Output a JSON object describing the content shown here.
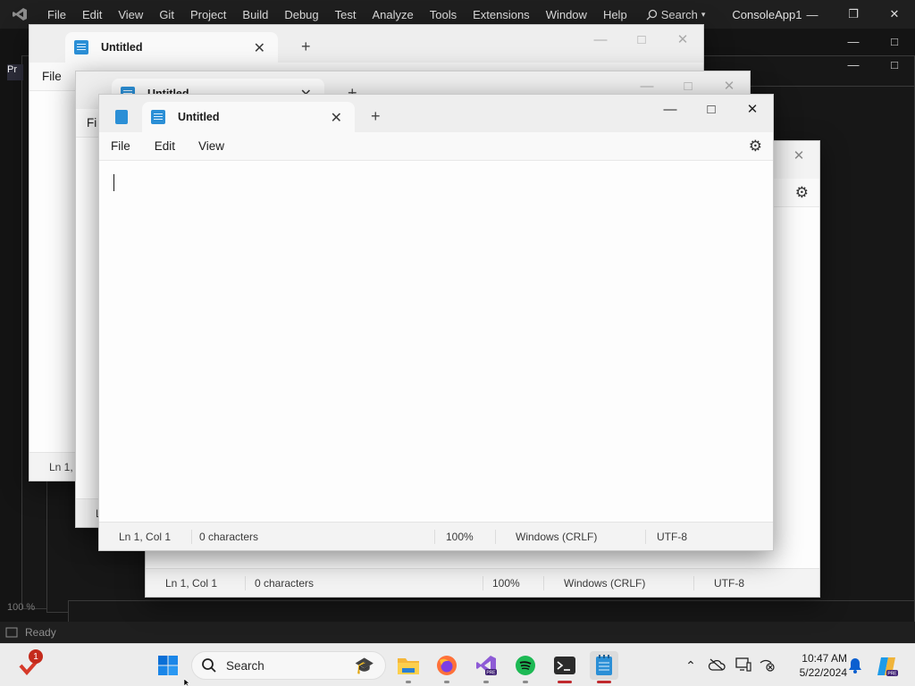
{
  "vs": {
    "menu": [
      "File",
      "Edit",
      "View",
      "Git",
      "Project",
      "Build",
      "Debug",
      "Test",
      "Analyze",
      "Tools",
      "Extensions",
      "Window",
      "Help"
    ],
    "search_label": "Search",
    "solution_name": "ConsoleApp1",
    "status_text": "Ready",
    "zoom_text": "100 %",
    "left_tab_label": "Pr"
  },
  "notepad_back": {
    "tab_title": "Untitled",
    "menu": [
      "File"
    ],
    "status": {
      "position": "Ln 1, C"
    }
  },
  "notepad_middle": {
    "tab_title": "Untitled",
    "menu": [
      "Fi"
    ],
    "status": {
      "position": "L"
    }
  },
  "notepad_right": {
    "status": {
      "position": "Ln 1, Col 1",
      "characters": "0 characters",
      "zoom": "100%",
      "line_ending": "Windows (CRLF)",
      "encoding": "UTF-8"
    }
  },
  "notepad_front": {
    "tab_title": "Untitled",
    "menu": [
      "File",
      "Edit",
      "View"
    ],
    "status": {
      "position": "Ln 1, Col 1",
      "characters": "0 characters",
      "zoom": "100%",
      "line_ending": "Windows (CRLF)",
      "encoding": "UTF-8"
    }
  },
  "taskbar": {
    "search_label": "Search",
    "notification_badge": "1",
    "time": "10:47 AM",
    "date": "5/22/2024",
    "pinned": [
      "start-icon",
      "file-explorer-icon",
      "firefox-icon",
      "visual-studio-preview-icon",
      "spotify-icon",
      "terminal-icon",
      "notepad-icon"
    ],
    "colors": {
      "start": "#0a6fd6",
      "spotify": "#1db954",
      "firefox": "#ff7139",
      "vs": "#8e5bd6"
    }
  }
}
